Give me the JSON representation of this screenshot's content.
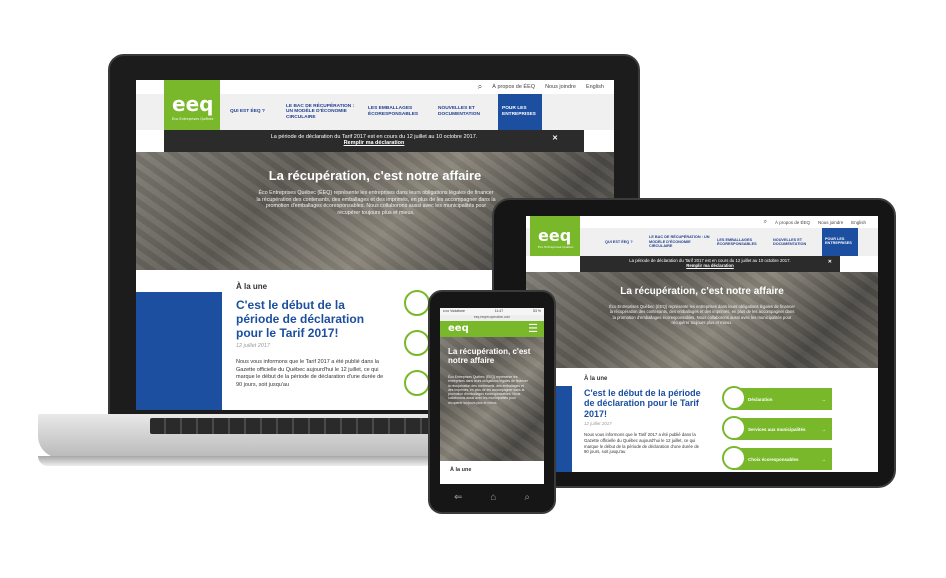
{
  "site": {
    "logo_text": "eeq",
    "logo_sub": "Éco Entreprises Québec",
    "util": {
      "about": "À propos de ÉEQ",
      "news": "Nous joindre",
      "lang": "English"
    },
    "nav": [
      {
        "label": "QUI EST ÉEQ ?"
      },
      {
        "label": "LE BAC DE RÉCUPÉRATION : UN MODÈLE D'ÉCONOMIE CIRCULAIRE"
      },
      {
        "label": "LES EMBALLAGES ÉCORESPONSABLES"
      },
      {
        "label": "NOUVELLES ET DOCUMENTATION"
      },
      {
        "label": "POUR LES ENTREPRISES"
      }
    ],
    "notice": {
      "text": "La période de déclaration du Tarif 2017 est en cours du 12 juillet au 10 octobre 2017.",
      "link": "Remplir ma déclaration",
      "close": "✕"
    },
    "hero_title": "La récupération, c'est notre affaire",
    "hero_text": "Éco Entreprises Québec (ÉEQ) représente les entreprises dans leurs obligations légales de financer la récupération des contenants, des emballages et des imprimés, en plus de les accompagner dans la promotion d'emballages écoresponsables. Nous collaborons aussi avec les municipalités pour récupérer toujours plus et mieux.",
    "kicker": "À la une",
    "headline": "C'est le début de la période de déclaration pour le Tarif 2017!",
    "date": "12 juillet 2017",
    "body": "Nous vous informons que le Tarif 2017 a été publié dans la Gazette officielle du Québec aujourd'hui le 12 juillet, ce qui marque le début de la période de déclaration d'une durée de 90 jours, soit jusqu'au",
    "ctas": [
      {
        "label": "Déclaration",
        "arrow": "→"
      },
      {
        "label": "Services aux municipalités",
        "arrow": "→"
      },
      {
        "label": "Choix écoresponsables",
        "arrow": "→"
      }
    ]
  },
  "phone": {
    "status_left": "••••• Vodafone",
    "status_time": "11:47",
    "status_right": "53 %",
    "url": "eeq.eeqrecuperation.com",
    "hero_title": "La récupération, c'est notre affaire",
    "hero_text": "Éco Entreprises Québec (ÉEQ) représente les entreprises dans leurs obligations légales de financer la récupération des contenants, des emballages et des imprimés, en plus de les accompagner dans la promotion d'emballages écoresponsables. Nous collaborons aussi avec les municipalités pour récupérer toujours plus et mieux.",
    "kicker": "À la une",
    "menu_icon": "☰",
    "nav_keys": [
      "⇐",
      "⌂",
      "⌕"
    ]
  },
  "colors": {
    "green": "#78b82a",
    "blue": "#1c4fa0",
    "dark": "#2b2b2b"
  }
}
